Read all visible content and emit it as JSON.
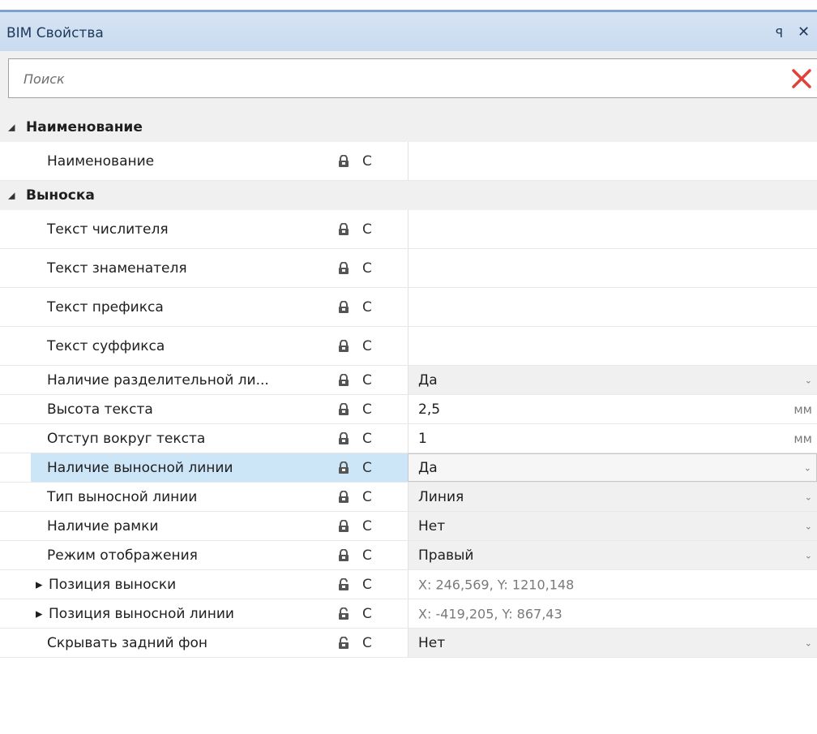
{
  "panel": {
    "title": "BIM Свойства",
    "pin_glyph": "ꟼ",
    "close_glyph": "✕"
  },
  "search": {
    "placeholder": "Поиск",
    "value": ""
  },
  "groups": [
    {
      "label": "Наименование",
      "expander": "◢"
    },
    {
      "label": "Выноска",
      "expander": "◢"
    }
  ],
  "rows": [
    {
      "label": "Наименование",
      "lock": "locked",
      "mark": "C",
      "value": ""
    },
    {
      "label": "Текст числителя",
      "lock": "locked",
      "mark": "C",
      "value": ""
    },
    {
      "label": "Текст знаменателя",
      "lock": "locked",
      "mark": "C",
      "value": ""
    },
    {
      "label": "Текст префикса",
      "lock": "locked",
      "mark": "C",
      "value": ""
    },
    {
      "label": "Текст суффикса",
      "lock": "locked",
      "mark": "C",
      "value": ""
    },
    {
      "label": "Наличие разделительной ли...",
      "lock": "locked",
      "mark": "C",
      "value": "Да",
      "dropdown": true
    },
    {
      "label": "Высота текста",
      "lock": "locked",
      "mark": "C",
      "value": "2,5",
      "unit": "мм"
    },
    {
      "label": "Отступ вокруг текста",
      "lock": "locked",
      "mark": "C",
      "value": "1",
      "unit": "мм"
    },
    {
      "label": "Наличие выносной линии",
      "lock": "locked",
      "mark": "C",
      "value": "Да",
      "dropdown": true,
      "selected": true
    },
    {
      "label": "Тип выносной линии",
      "lock": "locked",
      "mark": "C",
      "value": "Линия",
      "dropdown": true
    },
    {
      "label": "Наличие рамки",
      "lock": "locked",
      "mark": "C",
      "value": "Нет",
      "dropdown": true
    },
    {
      "label": "Режим отображения",
      "lock": "locked",
      "mark": "C",
      "value": "Правый",
      "dropdown": true
    },
    {
      "label": "Позиция выноски",
      "lock": "unlocked",
      "mark": "C",
      "value": "X: 246,569, Y: 1210,148",
      "expandable": true
    },
    {
      "label": "Позиция выносной линии",
      "lock": "unlocked",
      "mark": "C",
      "value": "X: -419,205, Y: 867,43",
      "expandable": true
    },
    {
      "label": "Скрывать задний фон",
      "lock": "unlocked",
      "mark": "C",
      "value": "Нет",
      "dropdown": true
    }
  ],
  "glyphs": {
    "row_expander": "▶",
    "dropdown_chevron": "⌄"
  },
  "colors": {
    "title_bg": "#c9dbf0",
    "selected_row": "#cde6f7",
    "clear_icon": "#e0413a",
    "lock_icon": "#555555"
  }
}
